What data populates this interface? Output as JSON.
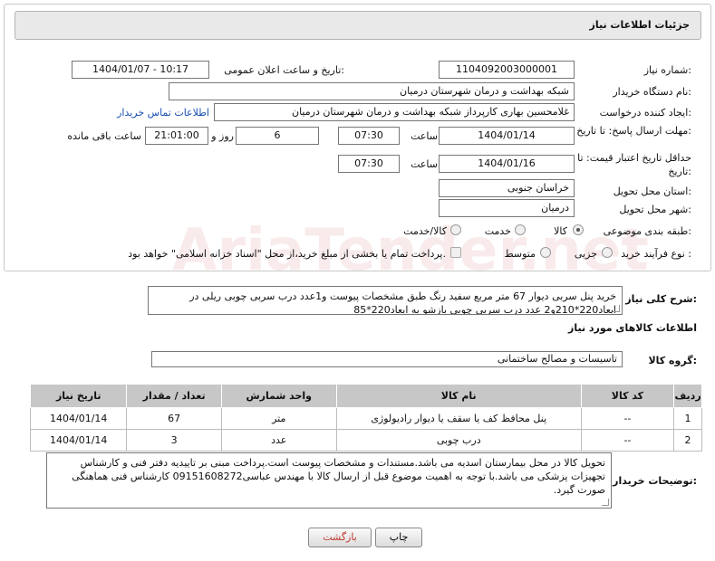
{
  "header": {
    "title": "جزئیات اطلاعات نیاز"
  },
  "fields": {
    "need_number_label": "شماره نیاز:",
    "need_number": "1104092003000001",
    "announce_label": "تاریخ و ساعت اعلان عمومی:",
    "announce_value": "1404/01/07 - 10:17",
    "buyer_org_label": "نام دستگاه خریدار:",
    "buyer_org": "شبکه بهداشت و درمان شهرستان درمیان",
    "creator_label": "ایجاد کننده درخواست:",
    "creator": "غلامحسین بهاری کارپرداز شبکه بهداشت و درمان شهرستان درمیان",
    "contact_link": "اطلاعات تماس خریدار",
    "deadline_label": "مهلت ارسال پاسخ: تا تاریخ:",
    "deadline_date": "1404/01/14",
    "time_label": "ساعت",
    "deadline_time": "07:30",
    "days": "6",
    "days_label": "روز و",
    "remaining_time": "21:01:00",
    "remaining_label": "ساعت باقی مانده",
    "price_validity_label": "حداقل تاریخ اعتبار قیمت: تا تاریخ:",
    "price_validity_date": "1404/01/16",
    "price_validity_time": "07:30",
    "province_label": "استان محل تحویل:",
    "province": "خراسان جنوبی",
    "city_label": "شهر محل تحویل:",
    "city": "درمیان",
    "category_label": "طبقه بندی موضوعی:",
    "category_options": [
      "کالا",
      "خدمت",
      "کالا/خدمت"
    ],
    "process_label": "نوع فرآیند خرید :",
    "process_options": [
      "جزیی",
      "متوسط"
    ],
    "payment_note": "پرداخت تمام یا بخشی از مبلغ خرید،از محل \"اسناد خزانه اسلامی\" خواهد بود."
  },
  "summary": {
    "label": "شرح کلی نیاز:",
    "text": "خرید پنل سربی دیوار 67 متر مربع سفید رنگ طبق مشخصات پیوست و1عدد درب سربی چوبی ریلی در ابعاد220*210و2 عدد درب سربی چوبی بازشو به ابعاد220*85"
  },
  "goods": {
    "section_title": "اطلاعات کالاهای مورد نیاز",
    "group_label": "گروه کالا:",
    "group_value": "تاسیسات و مصالح ساختمانی",
    "columns": [
      "ردیف",
      "کد کالا",
      "نام کالا",
      "واحد شمارش",
      "تعداد / مقدار",
      "تاریخ نیاز"
    ],
    "rows": [
      [
        "1",
        "--",
        "پنل محافظ کف یا سقف یا دیوار رادیولوژی",
        "متر",
        "67",
        "1404/01/14"
      ],
      [
        "2",
        "--",
        "درب چوبی",
        "عدد",
        "3",
        "1404/01/14"
      ]
    ]
  },
  "buyer_notes": {
    "label": "توضیحات خریدار:",
    "text": "تحویل کالا در محل بیمارستان اسدیه می باشد.مستندات و مشخصات پیوست است.پرداخت مبنی بر تاییدیه دفتر فنی و کارشناس تجهیزات پزشکی می باشد.با توجه به اهمیت موضوع قبل از ارسال کالا با مهندس عباسی09151608272 کارشناس فنی هماهنگی صورت گیرد."
  },
  "buttons": {
    "print": "چاپ",
    "back": "بازگشت"
  },
  "watermark": "AriaTender.net",
  "colors": {
    "header_bg": "#e9e9e9",
    "table_header_bg": "#c7c7c7",
    "link": "#1a4fb5",
    "back_button_text": "#c0392b"
  }
}
